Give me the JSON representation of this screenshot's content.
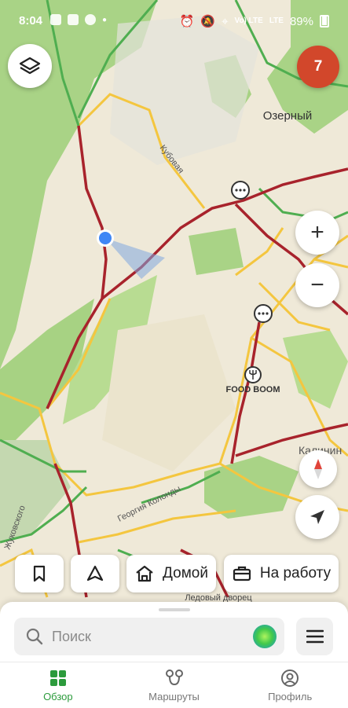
{
  "status_bar": {
    "time": "8:04",
    "network": "Vo) LTE",
    "network2": "LTE",
    "battery": "89%"
  },
  "map": {
    "place_ozerny": "Озерный",
    "street_kubovaya": "Кубовая",
    "street_georgiya": "Георгия Колонды",
    "street_zhukovskogo": "Жуковского",
    "poi_food": "FOOD BOOM",
    "street_kalinin": "Калинин",
    "poi_ice": "Ледовый дворец"
  },
  "traffic_level": "7",
  "chips": {
    "home": "Домой",
    "work": "На работу"
  },
  "search": {
    "placeholder": "Поиск"
  },
  "tabs": {
    "overview": "Обзор",
    "routes": "Маршруты",
    "profile": "Профиль"
  },
  "colors": {
    "accent": "#2c9b3c",
    "traffic": "#d2472b",
    "location": "#3f86f5"
  }
}
